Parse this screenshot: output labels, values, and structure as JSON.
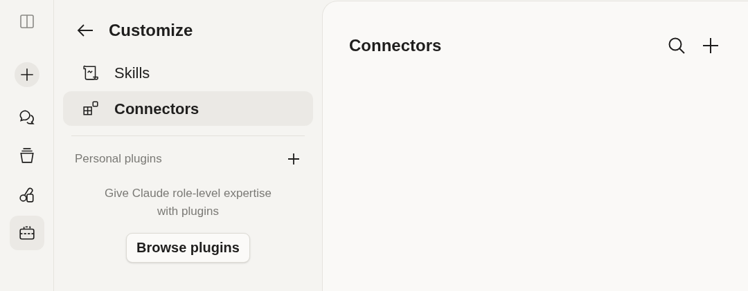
{
  "rail": {
    "items": [
      {
        "kind": "new"
      },
      {
        "kind": "chats",
        "selected": false
      },
      {
        "kind": "projects",
        "selected": false
      },
      {
        "kind": "artifacts",
        "selected": false
      },
      {
        "kind": "customize",
        "selected": true
      }
    ]
  },
  "panel": {
    "title": "Customize",
    "items": [
      {
        "label": "Skills",
        "kind": "skills",
        "selected": false
      },
      {
        "label": "Connectors",
        "kind": "connectors",
        "selected": true
      }
    ],
    "section": {
      "title": "Personal plugins",
      "empty_text": "Give Claude role-level expertise with plugins",
      "button": "Browse plugins"
    }
  },
  "main": {
    "title": "Connectors"
  }
}
